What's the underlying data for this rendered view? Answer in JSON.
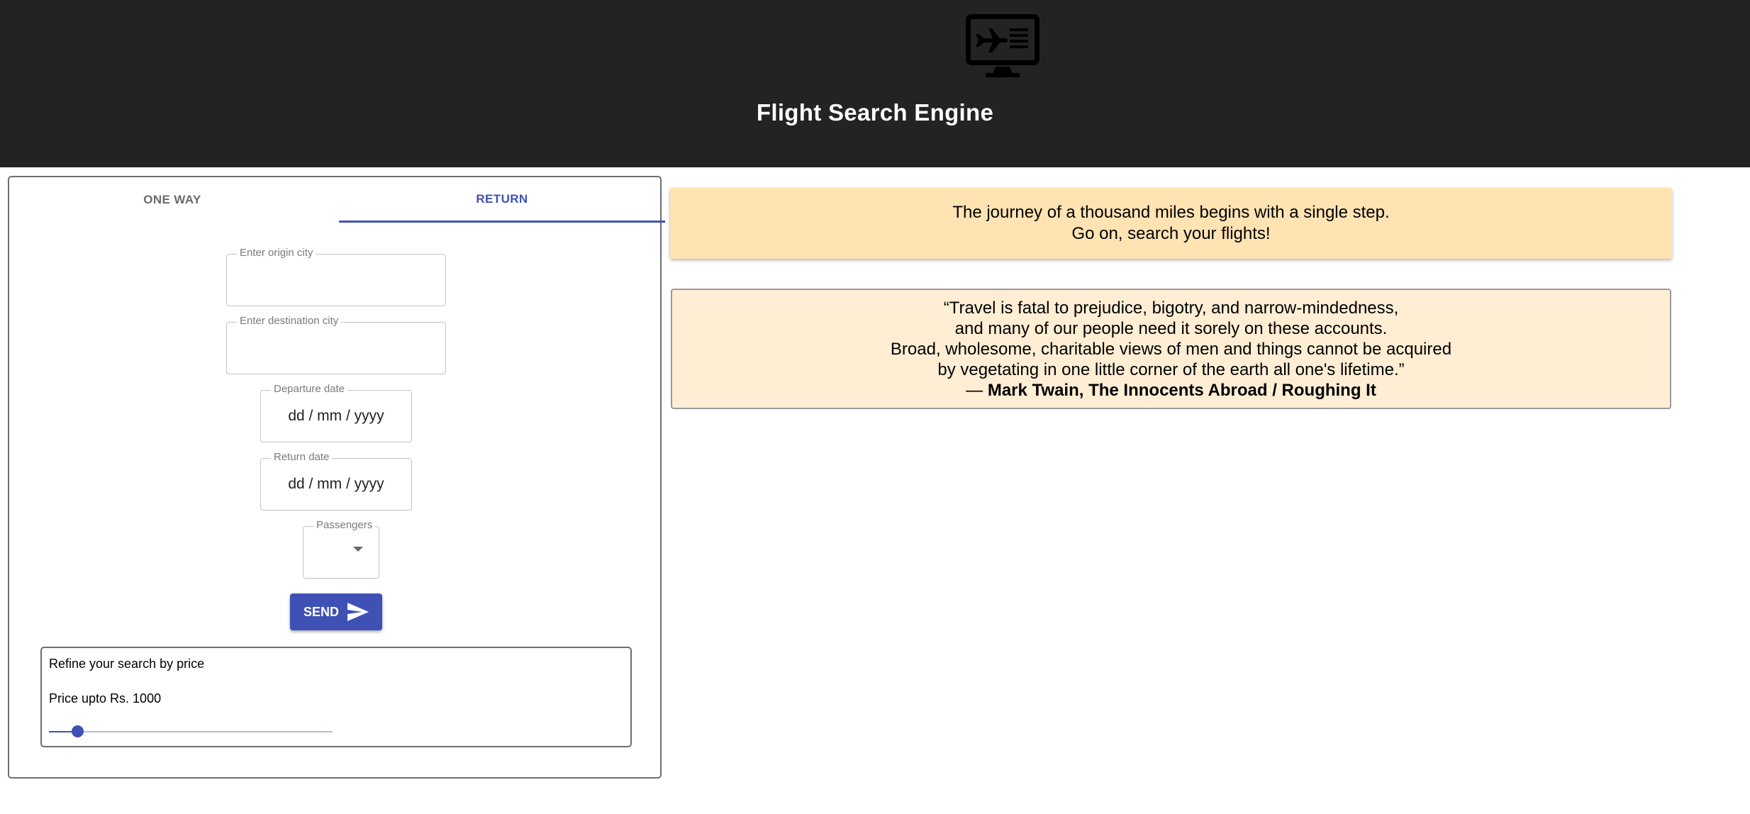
{
  "header": {
    "title": "Flight Search Engine",
    "logo_icon": "computer-airplane-icon"
  },
  "tabs": [
    {
      "label": "ONE WAY",
      "active": false
    },
    {
      "label": "RETURN",
      "active": true
    }
  ],
  "form": {
    "origin": {
      "label": "Enter origin city",
      "value": ""
    },
    "destination": {
      "label": "Enter destination city",
      "value": ""
    },
    "departure": {
      "label": "Departure date",
      "value": "dd / mm / yyyy"
    },
    "return": {
      "label": "Return date",
      "value": "dd / mm / yyyy"
    },
    "passengers": {
      "label": "Passengers",
      "value": ""
    },
    "send_label": "SEND",
    "send_icon": "send-icon"
  },
  "refine": {
    "title": "Refine your search by price",
    "price_label": "Price upto Rs. 1000",
    "slider_fraction": 0.1
  },
  "banner": {
    "line1": "The journey of a thousand miles begins with a single step.",
    "line2": "Go on, search your flights!"
  },
  "quote": {
    "line1": "“Travel is fatal to prejudice, bigotry, and narrow-mindedness,",
    "line2": "and many of our people need it sorely on these accounts.",
    "line3": "Broad, wholesome, charitable views of men and things cannot be acquired",
    "line4": "by vegetating in one little corner of the earth all one's lifetime.”",
    "dash": "— ",
    "author": "Mark Twain, The Innocents Abroad / Roughing It"
  },
  "colors": {
    "header_bg": "#232323",
    "accent": "#3f51b5",
    "banner_bg": "#ffe3b3",
    "quote_bg": "#ffeed4"
  }
}
